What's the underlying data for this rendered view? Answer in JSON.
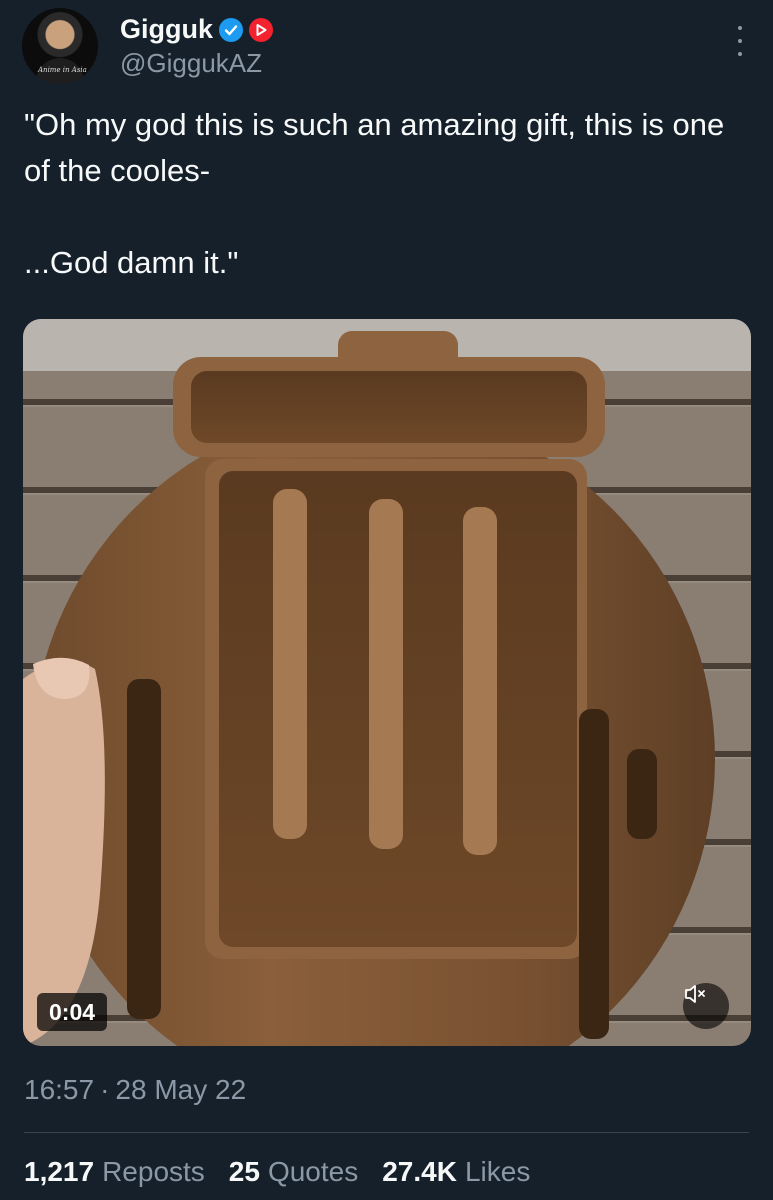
{
  "author": {
    "name": "Gigguk",
    "handle": "@GiggukAZ",
    "avatar_caption": "Anime in Asia",
    "verified_color": "#1d9bf0",
    "affiliate_badge_color": "#f4212e"
  },
  "tweet": {
    "text": "\"Oh my god this is such an amazing gift, this is one of the cooles-\n\n...God damn it.\""
  },
  "media": {
    "type": "video",
    "duration": "0:04",
    "muted": true,
    "mute_icon": "speaker-muted-icon"
  },
  "meta": {
    "time": "16:57",
    "separator": "·",
    "date": "28 May 22"
  },
  "stats": {
    "reposts_count": "1,217",
    "reposts_label": "Reposts",
    "quotes_count": "25",
    "quotes_label": "Quotes",
    "likes_count": "27.4K",
    "likes_label": "Likes"
  }
}
